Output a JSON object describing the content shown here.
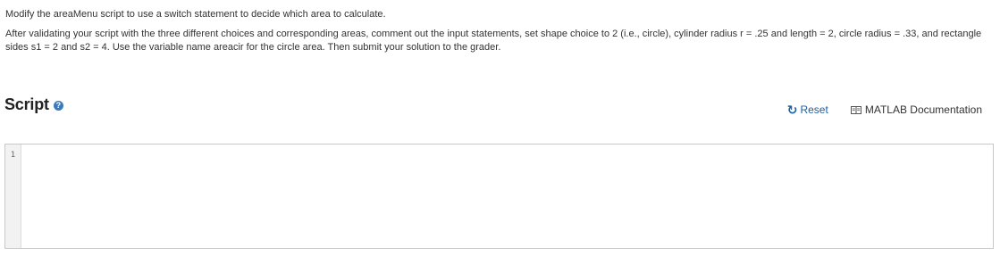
{
  "instructions": {
    "paragraph1": "Modify the areaMenu script to use a switch statement to decide which area to calculate.",
    "paragraph2": "After validating your script with the three different choices and corresponding areas, comment out the input statements, set shape choice to 2 (i.e., circle), cylinder radius r = .25 and length = 2, circle radius = .33, and rectangle sides s1 = 2 and s2 = 4.  Use the variable name areacir for the circle area.  Then submit your solution to the grader."
  },
  "script_panel": {
    "title": "Script",
    "help_icon": "question-circle-icon"
  },
  "toolbar": {
    "reset_label": "Reset",
    "reset_icon": "refresh-icon",
    "doc_label": "MATLAB Documentation",
    "doc_icon": "book-icon"
  },
  "editor": {
    "line_numbers": [
      "1"
    ],
    "code": ""
  },
  "colors": {
    "link_blue": "#1a5fa8",
    "help_icon_blue": "#3d7ab8"
  }
}
